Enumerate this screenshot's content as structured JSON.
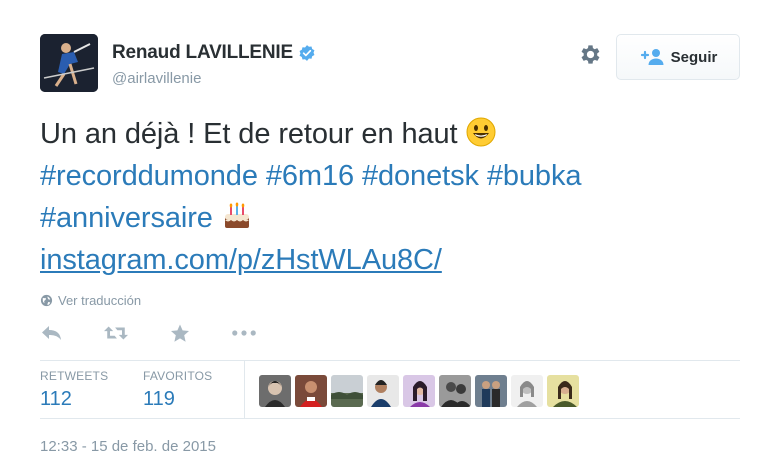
{
  "user": {
    "name": "Renaud LAVILLENIE",
    "handle": "@airlavillenie",
    "verified": true
  },
  "header": {
    "follow_label": "Seguir",
    "gear_icon": "gear-icon",
    "follow_icon": "follow-person-plus-icon"
  },
  "tweet": {
    "line1_text": "Un an déjà ! Et de retour en haut ",
    "line1_emoji": "smiley-face-emoji",
    "hashtags_line2": [
      "#recorddumonde",
      "#6m16",
      "#donetsk",
      "#bubka"
    ],
    "hashtag_line3": "#anniversaire",
    "line3_emoji": "birthday-cake-emoji",
    "link": "instagram.com/p/zHstWLAu8C/"
  },
  "translate": {
    "label": "Ver traducción",
    "icon": "globe-icon"
  },
  "actions": [
    "reply-icon",
    "retweet-icon",
    "favorite-star-icon",
    "more-dots-icon"
  ],
  "stats": {
    "retweets_label": "RETWEETS",
    "retweets_value": "112",
    "favorites_label": "FAVORITOS",
    "favorites_value": "119"
  },
  "favoriters_count_shown": 9,
  "timestamp": "12:33 - 15 de feb. de 2015",
  "colors": {
    "link_blue": "#2b7bb9",
    "muted_gray": "#8899a6",
    "text_dark": "#292f33",
    "verified_blue": "#55acee",
    "border": "#e1e8ed"
  }
}
